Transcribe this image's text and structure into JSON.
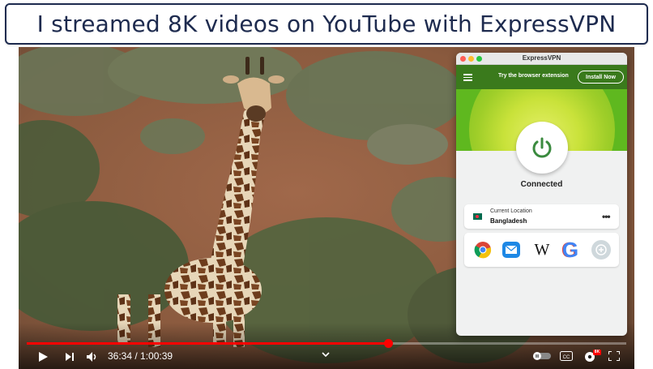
{
  "banner": {
    "title": "I streamed 8K videos on YouTube with ExpressVPN"
  },
  "player": {
    "current_time": "36:34",
    "separator": " / ",
    "duration": "1:00:39",
    "progress_fraction": 0.603,
    "quality_badge": "8K",
    "accent_color": "#ff0000",
    "icons": [
      "play-icon",
      "next-icon",
      "volume-icon",
      "chevron-down-icon",
      "autoplay-toggle-icon",
      "captions-icon",
      "settings-icon",
      "fullscreen-icon"
    ]
  },
  "vpn": {
    "window_title": "ExpressVPN",
    "header_text": "Try the browser extension",
    "install_button": "Install Now",
    "status": "Connected",
    "location_label": "Current Location",
    "location_value": "Bangladesh",
    "shortcuts": [
      "chrome-icon",
      "mail-icon",
      "wikipedia-icon",
      "google-icon",
      "add-shortcut-icon"
    ],
    "wiki_glyph": "W",
    "google_glyph": "G",
    "brand_green": "#3a7a1c",
    "connected_green": "#5fb81f"
  }
}
